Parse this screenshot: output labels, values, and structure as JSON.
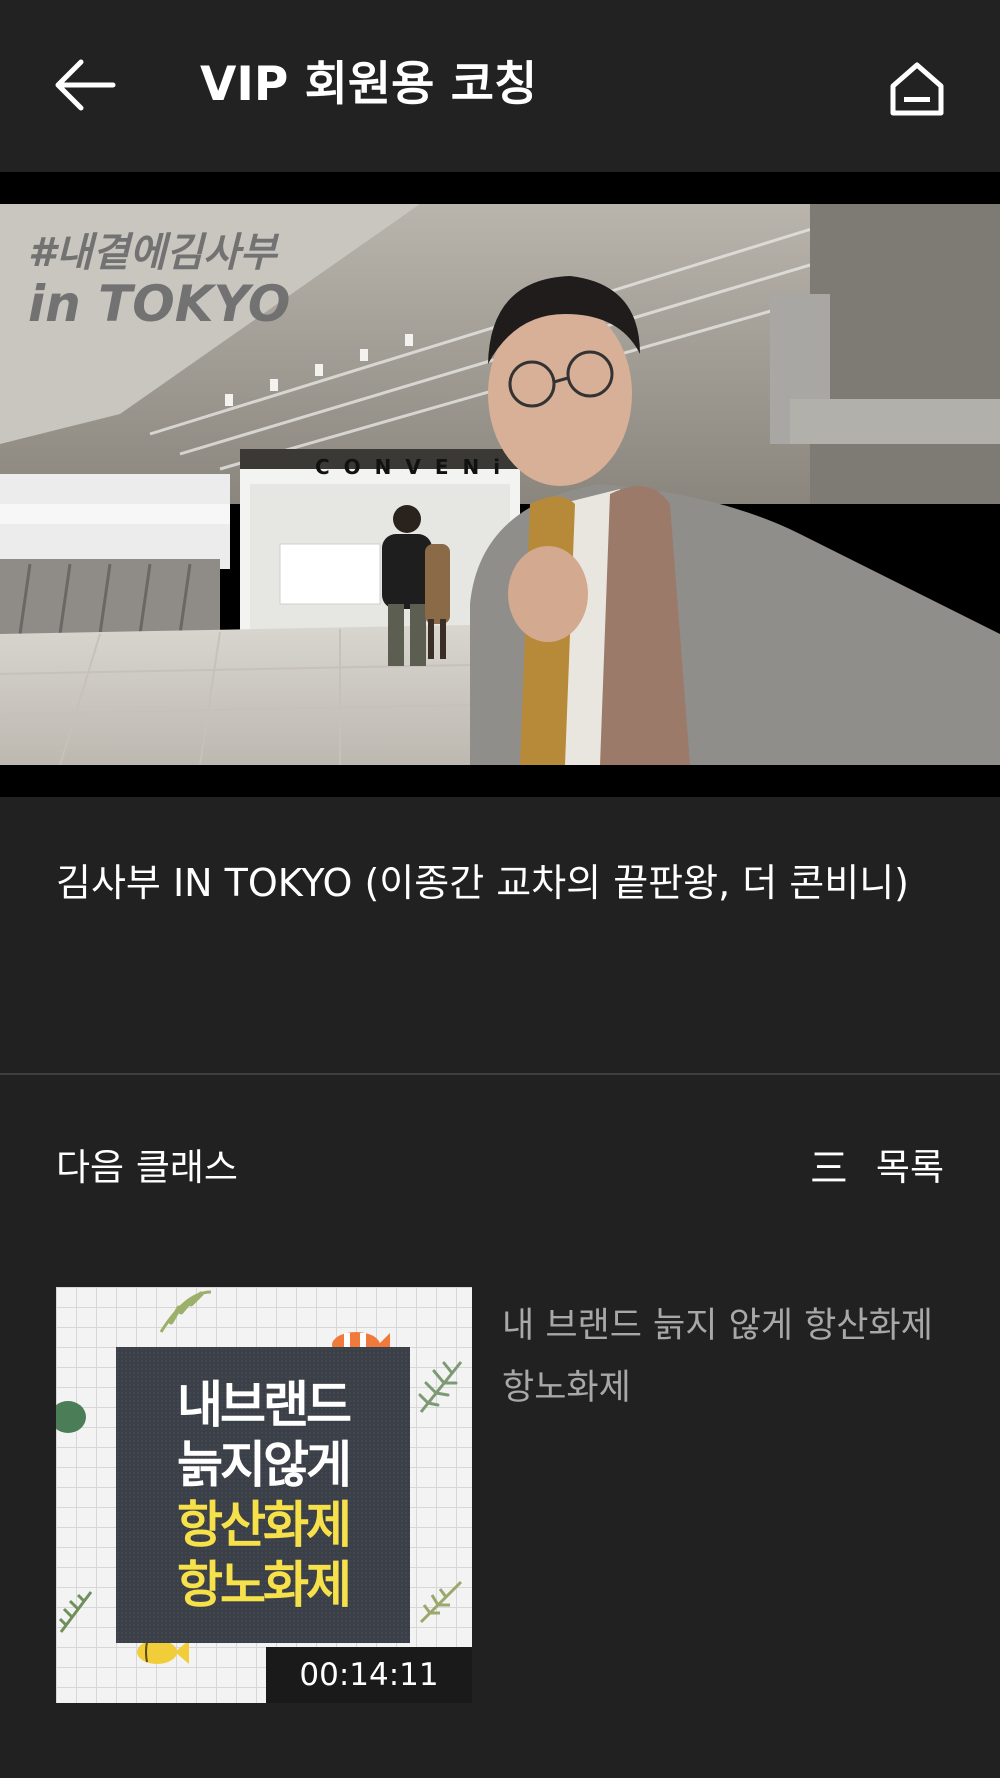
{
  "header": {
    "title": "VIP 회원용 코칭",
    "back_icon": "arrow-left-icon",
    "home_icon": "home-icon"
  },
  "video": {
    "overlay_line1": "#내곁에김사부",
    "overlay_line2": "in TOKYO",
    "store_sign": "CONVENi",
    "title": "김사부 IN TOKYO (이종간 교차의 끝판왕, 더 콘비니)"
  },
  "next_section": {
    "label": "다음 클래스",
    "list_icon": "list-icon",
    "list_glyph": "三",
    "list_label": "목록"
  },
  "next_class": {
    "thumb_line1": "내브랜드",
    "thumb_line2": "늙지않게",
    "thumb_line3": "항산화제",
    "thumb_line4": "항노화제",
    "duration": "00:14:11",
    "title": "내 브랜드 늙지 않게 항산화제 항노화제"
  },
  "colors": {
    "background": "#212121",
    "header": "#222222",
    "text_primary": "#ffffff",
    "text_secondary": "#a8a8a8",
    "thumb_highlight": "#f7e14a"
  }
}
